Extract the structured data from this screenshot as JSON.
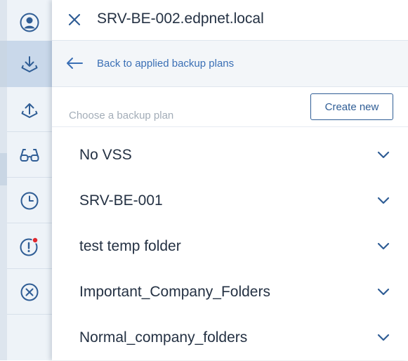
{
  "panel": {
    "title": "SRV-BE-002.edpnet.local",
    "back_link": "Back to applied backup plans",
    "choose_label": "Choose a backup plan",
    "create_button": "Create new"
  },
  "sidebar": {
    "items": [
      {
        "icon": "user-icon",
        "active": false
      },
      {
        "icon": "download-icon",
        "active": true
      },
      {
        "icon": "upload-icon",
        "active": false
      },
      {
        "icon": "glasses-icon",
        "active": false
      },
      {
        "icon": "clock-icon",
        "active": false
      },
      {
        "icon": "alert-icon",
        "active": false,
        "badge": true
      },
      {
        "icon": "cancel-icon",
        "active": false
      }
    ]
  },
  "plans": [
    {
      "name": "No VSS"
    },
    {
      "name": "SRV-BE-001"
    },
    {
      "name": "test temp folder"
    },
    {
      "name": "Important_Company_Folders"
    },
    {
      "name": "Normal_company_folders"
    }
  ],
  "colors": {
    "accent": "#2f5d95",
    "link": "#3a6fb5",
    "alert_badge": "#e0282e",
    "rail_bg": "#eef3f8",
    "rail_active": "#c9d8ea"
  }
}
